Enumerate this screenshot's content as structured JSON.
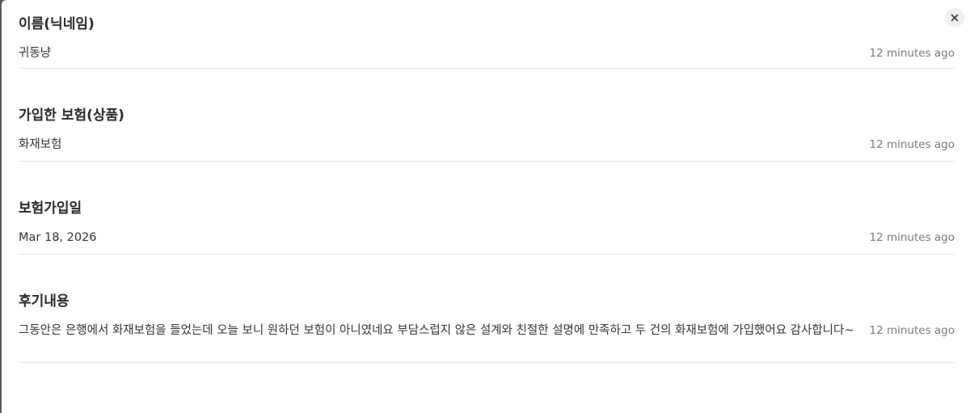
{
  "dialog": {
    "close_icon": "close-icon",
    "entries": [
      {
        "title": "이름(닉네임)",
        "value": "귀동냥",
        "time": "12 minutes ago"
      },
      {
        "title": "가입한 보험(상품)",
        "value": "화재보험",
        "time": "12 minutes ago"
      },
      {
        "title": "보험가입일",
        "value": "Mar 18, 2026",
        "time": "12 minutes ago"
      },
      {
        "title": "후기내용",
        "value": "그동안은 은행에서 화재보험을 들었는데 오늘 보니 원하던 보험이 아니였네요 부담스럽지 않은 설계와 친절한 설명에 만족하고 두 건의 화재보험에 가입했어요 감사합니다~",
        "time": "12 minutes ago"
      }
    ]
  }
}
